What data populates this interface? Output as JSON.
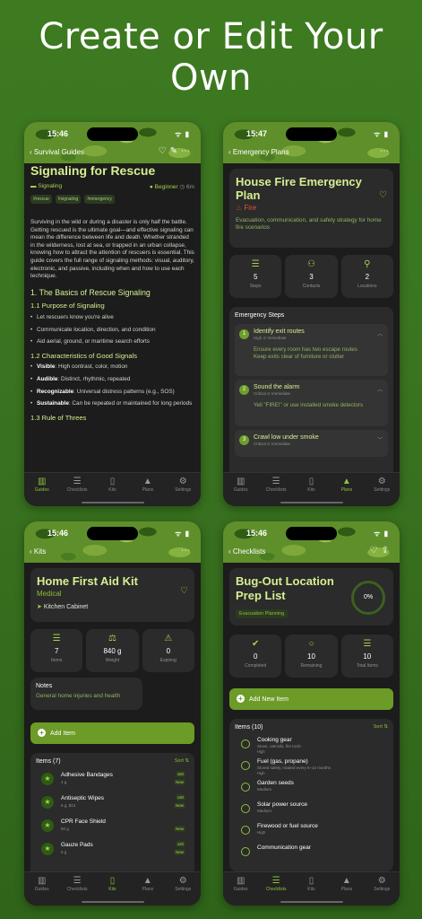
{
  "headline": "Create or Edit Your Own",
  "status": {
    "time_1": "15:46",
    "time_2": "15:47",
    "time_3": "15:46",
    "time_4": "15:46",
    "signal": "ᯤ ▮"
  },
  "tabs": {
    "guides": "Guides",
    "checklists": "Checklists",
    "kits": "Kits",
    "plans": "Plans",
    "settings": "Settings"
  },
  "guide": {
    "back": "Survival Guides",
    "title": "Signaling for Rescue",
    "category": "Signaling",
    "level": "Beginner",
    "duration": "6m",
    "tags": [
      "#rescue",
      "#signaling",
      "#emergency"
    ],
    "intro": "Surviving in the wild or during a disaster is only half the battle. Getting rescued is the ultimate goal—and effective signaling can mean the difference between life and death. Whether stranded in the wilderness, lost at sea, or trapped in an urban collapse, knowing how to attract the attention of rescuers is essential. This guide covers the full range of signaling methods: visual, auditory, electronic, and passive, including when and how to use each technique.",
    "h1": "1. The Basics of Rescue Signaling",
    "h11": "1.1 Purpose of Signaling",
    "purpose": [
      "Let rescuers know you're alive",
      "Communicate location, direction, and condition",
      "Aid aerial, ground, or maritime search efforts"
    ],
    "h12": "1.2 Characteristics of Good Signals",
    "chars": [
      {
        "k": "Visible",
        "v": ": High contrast, color, motion"
      },
      {
        "k": "Audible",
        "v": ": Distinct, rhythmic, repeated"
      },
      {
        "k": "Recognizable",
        "v": ": Universal distress patterns (e.g., SOS)"
      },
      {
        "k": "Sustainable",
        "v": ": Can be repeated or maintained for long periods"
      }
    ],
    "h13": "1.3 Rule of Threes"
  },
  "plan": {
    "back": "Emergency Plans",
    "title": "House Fire Emergency Plan",
    "category": "Fire",
    "description": "Evacuation, communication, and safety strategy for home fire scenarios",
    "stats": [
      {
        "value": "5",
        "label": "Steps"
      },
      {
        "value": "3",
        "label": "Contacts"
      },
      {
        "value": "2",
        "label": "Locations"
      }
    ],
    "steps_header": "Emergency Steps",
    "steps": [
      {
        "num": "1",
        "title": "Identify exit routes",
        "meta": "High  ⊙ Immediate",
        "detail": "Ensure every room has two escape routes\nKeep exits clear of furniture or clutter"
      },
      {
        "num": "2",
        "title": "Sound the alarm",
        "meta": "Critical  ⊙ Immediate",
        "detail": "Yell \"FIRE!\" or use installed smoke detectors"
      },
      {
        "num": "3",
        "title": "Crawl low under smoke",
        "meta": "Critical  ⊙ Immediate",
        "detail": ""
      }
    ]
  },
  "kit": {
    "back": "Kits",
    "title": "Home First Aid Kit",
    "category": "Medical",
    "location": "Kitchen Cabinet",
    "stats": [
      {
        "value": "7",
        "label": "Items"
      },
      {
        "value": "840 g",
        "label": "Weight"
      },
      {
        "value": "0",
        "label": "Expiring"
      }
    ],
    "notes_label": "Notes",
    "notes": "General home injuries and health",
    "add_label": "Add Item",
    "items_header": "Items (7)",
    "sort": "Sort ⇅",
    "items": [
      {
        "name": "Adhesive Bandages",
        "detail": "4 g",
        "qty": "x50",
        "badge": "New"
      },
      {
        "name": "Antiseptic Wipes",
        "detail": "6 g, $13",
        "qty": "x30",
        "badge": "New"
      },
      {
        "name": "CPR Face Shield",
        "detail": "50 g",
        "qty": "",
        "badge": "New"
      },
      {
        "name": "Gauze Pads",
        "detail": "6 g",
        "qty": "x20",
        "badge": "New"
      }
    ]
  },
  "checklist": {
    "back": "Checklists",
    "title": "Bug-Out Location Prep List",
    "category": "Evacuation Planning",
    "progress": "0%",
    "stats": [
      {
        "value": "0",
        "label": "Completed"
      },
      {
        "value": "10",
        "label": "Remaining"
      },
      {
        "value": "10",
        "label": "Total Items"
      }
    ],
    "add_label": "Add New Item",
    "items_header": "Items (10)",
    "sort": "Sort ⇅",
    "items": [
      {
        "name": "Cooking gear",
        "detail": "Stove, utensils, fire tools",
        "priority": "High"
      },
      {
        "name": "Fuel (gas, propane)",
        "detail": "Stored safely, rotated every 6–12 months",
        "priority": "High"
      },
      {
        "name": "Garden seeds",
        "detail": "",
        "priority": "Medium"
      },
      {
        "name": "Solar power source",
        "detail": "",
        "priority": "Medium"
      },
      {
        "name": "Firewood or fuel source",
        "detail": "",
        "priority": "High"
      },
      {
        "name": "Communication gear",
        "detail": "",
        "priority": ""
      }
    ]
  }
}
